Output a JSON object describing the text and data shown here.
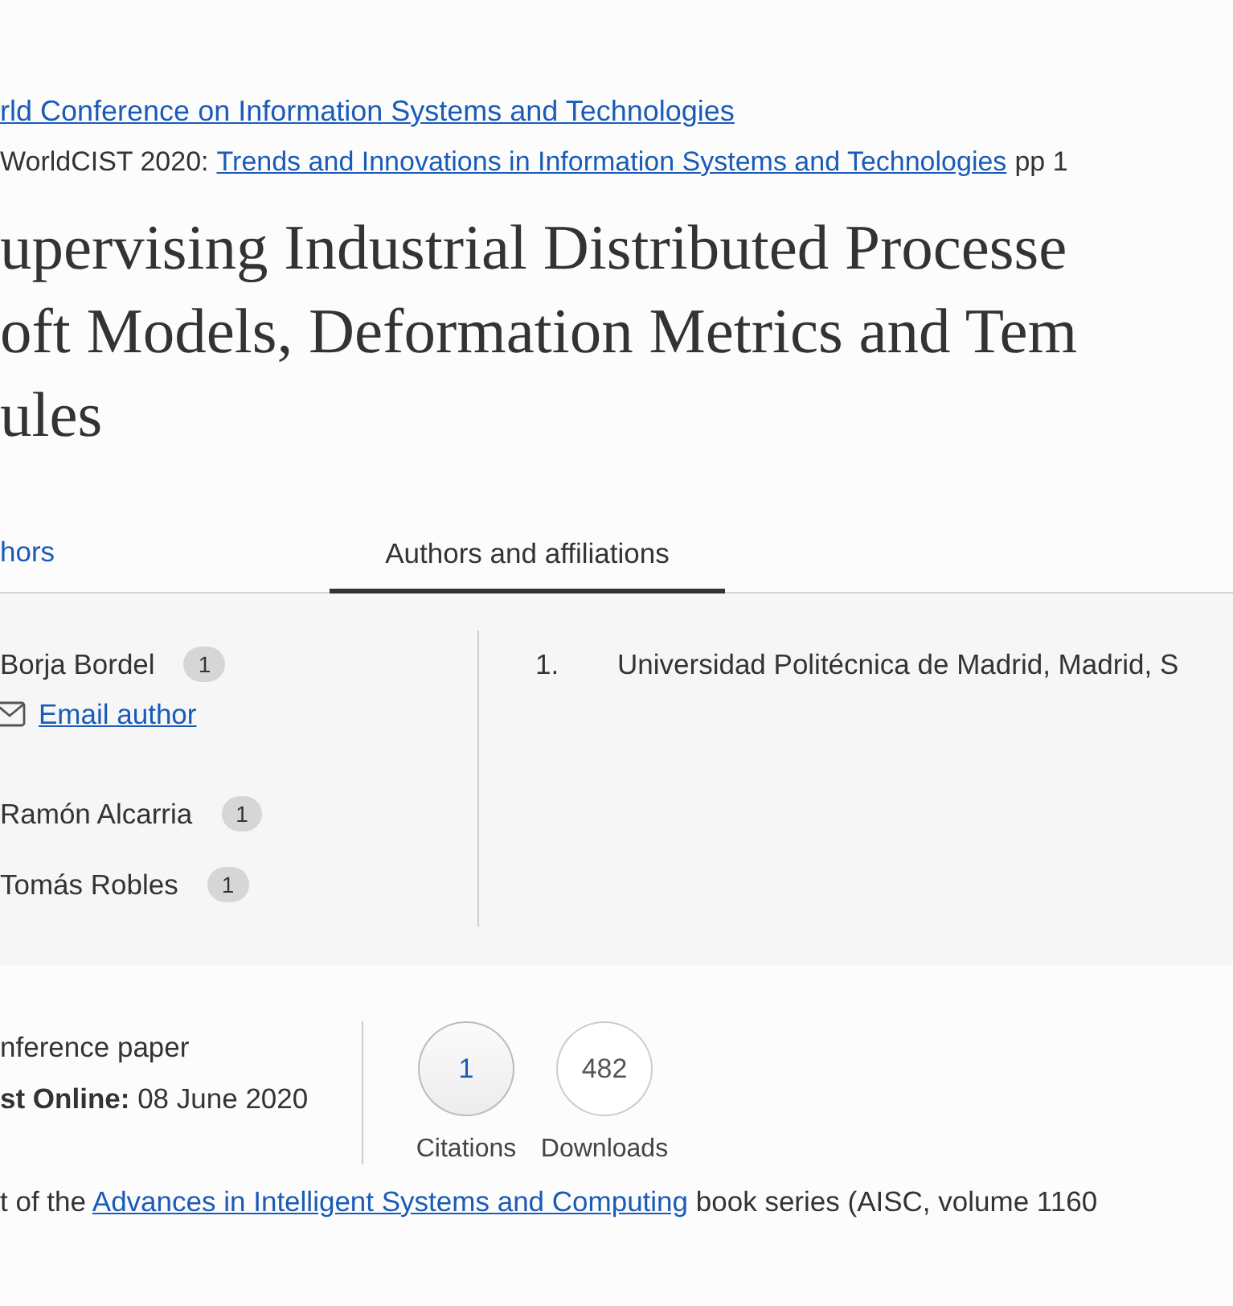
{
  "conference_link": "rld Conference on Information Systems and Technologies",
  "proceedings": {
    "prefix": "WorldCIST 2020:",
    "link": "Trends and Innovations in Information Systems and Technologies",
    "suffix": "pp 1"
  },
  "title_lines": [
    "upervising Industrial Distributed Processe",
    "oft Models, Deformation Metrics and Tem",
    "ules"
  ],
  "tabs": [
    {
      "label": "hors",
      "selected": false
    },
    {
      "label": "Authors and affiliations",
      "selected": true
    }
  ],
  "authors": [
    {
      "name": "Borja Bordel",
      "badge": "1",
      "email": "Email author"
    },
    {
      "name": "Ramón Alcarria",
      "badge": "1"
    },
    {
      "name": "Tomás Robles",
      "badge": "1"
    }
  ],
  "affiliations": [
    {
      "number": "1.",
      "text": "Universidad Politécnica de Madrid, Madrid, S"
    }
  ],
  "meta": {
    "type": "nference paper",
    "online_label": "st Online:",
    "online_date": "08 June 2020"
  },
  "metrics": [
    {
      "value": "1",
      "label": "Citations",
      "kind": "link"
    },
    {
      "value": "482",
      "label": "Downloads",
      "kind": "plain"
    }
  ],
  "series": {
    "prefix": "t of the",
    "link": "Advances in Intelligent Systems and Computing",
    "suffix": "book series (AISC, volume 1160"
  }
}
